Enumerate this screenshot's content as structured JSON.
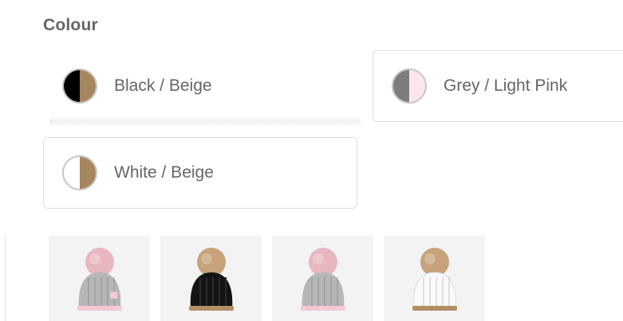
{
  "colour_section": {
    "title": "Colour",
    "options": [
      {
        "label": "Black / Beige",
        "left_color": "#000000",
        "right_color": "#a6865e",
        "selected": true
      },
      {
        "label": "Grey / Light Pink",
        "left_color": "#7d7d7d",
        "right_color": "#fbe6eb",
        "selected": false
      },
      {
        "label": "White / Beige",
        "left_color": "#ffffff",
        "right_color": "#a6865e",
        "selected": false
      }
    ]
  },
  "thumbnails": [
    {
      "name": "grey-light-pink-hat",
      "hat_color": "#b6b6b8",
      "pompom_color": "#e8b6bf",
      "band_color": "#f2c9d2",
      "badge": true
    },
    {
      "name": "black-beige-hat",
      "hat_color": "#141414",
      "pompom_color": "#c7a27a",
      "band_color": "#b48e64",
      "badge": false
    },
    {
      "name": "grey-light-pink-hat-alt",
      "hat_color": "#b6b6b8",
      "pompom_color": "#e8b6bf",
      "band_color": "#f2c9d2",
      "badge": false
    },
    {
      "name": "white-beige-hat",
      "hat_color": "#fafafa",
      "pompom_color": "#c7a27a",
      "band_color": "#b48e64",
      "badge": false
    }
  ]
}
